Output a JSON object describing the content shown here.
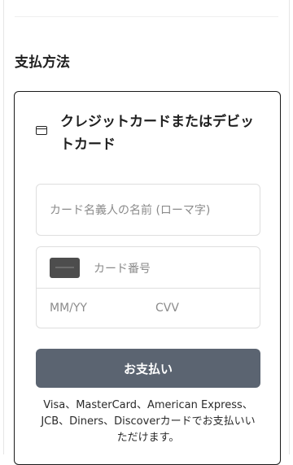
{
  "payment": {
    "section_title": "支払方法",
    "method": {
      "icon": "credit-card-icon",
      "title": "クレジットカードまたはデビットカード"
    },
    "fields": {
      "cardholder_placeholder": "カード名義人の名前 (ローマ字)",
      "card_number_placeholder": "カード番号",
      "expiry_placeholder": "MM/YY",
      "cvv_placeholder": "CVV"
    },
    "pay_button_label": "お支払い",
    "accepted_cards_note": "Visa、MasterCard、American Express、JCB、Diners、Discoverカードでお支払いいただけます。"
  },
  "colors": {
    "button_bg": "#5b6471",
    "panel_border": "#1a1a1a",
    "field_border": "#dedede",
    "placeholder": "#8b8b8b"
  }
}
